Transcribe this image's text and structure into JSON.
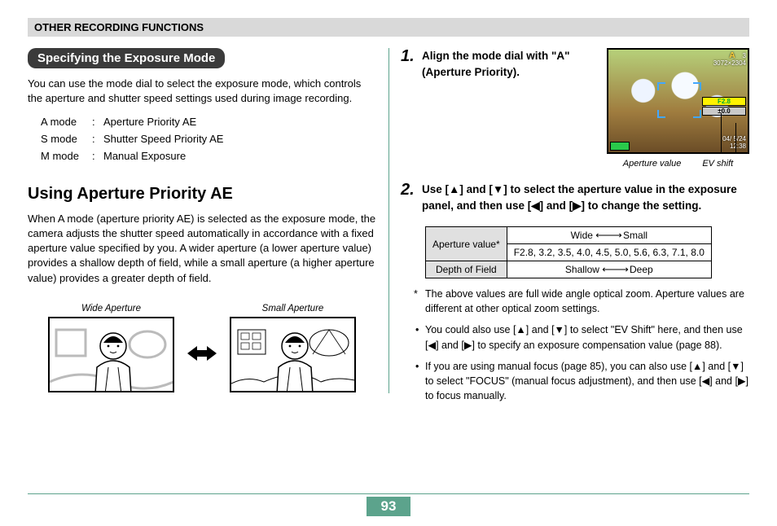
{
  "chapter": "OTHER RECORDING FUNCTIONS",
  "section_title": "Specifying the Exposure Mode",
  "intro": "You can use the mode dial to select the exposure mode, which controls the aperture and shutter speed settings used during image recording.",
  "modes": [
    {
      "k": "A mode",
      "v": "Aperture Priority AE"
    },
    {
      "k": "S mode",
      "v": "Shutter Speed Priority AE"
    },
    {
      "k": "M mode",
      "v": "Manual Exposure"
    }
  ],
  "sub_heading": "Using Aperture Priority AE",
  "sub_body": "When A mode (aperture priority AE) is selected as the exposure mode, the camera adjusts the shutter speed automatically in accordance with a fixed aperture value specified by you. A wider aperture (a lower aperture value) provides a shallow depth of field, while a small aperture (a higher aperture value) provides a greater depth of field.",
  "fig_wide_cap": "Wide Aperture",
  "fig_small_cap": "Small Aperture",
  "step1_num": "1.",
  "step1_text": "Align the mode dial with \"A\" (Aperture Priority).",
  "screen": {
    "a_label": "A",
    "count": "3",
    "res": "3072×2304",
    "f": "F2.8",
    "ev": "±0.0",
    "date": "04/ 5/24",
    "time": "12:38",
    "caption_l": "Aperture value",
    "caption_r": "EV shift"
  },
  "step2_num": "2.",
  "step2_text": "Use [▲] and [▼] to select the aperture value in the exposure panel, and then use [◀] and [▶] to change the setting.",
  "table": {
    "row1_label": "Aperture value*",
    "row1_scale_l": "Wide",
    "row1_scale_r": "Small",
    "row1_values": "F2.8, 3.2, 3.5, 4.0, 4.5, 5.0, 5.6, 6.3, 7.1, 8.0",
    "row2_label": "Depth of Field",
    "row2_scale_l": "Shallow",
    "row2_scale_r": "Deep"
  },
  "footnote": "The above values are full wide angle optical zoom. Aperture values are different at other optical zoom settings.",
  "bullets": [
    "You could also use [▲] and [▼] to select \"EV Shift\" here, and then use [◀] and [▶] to specify an exposure compensation value (page 88).",
    "If you are using manual focus (page 85), you can also use [▲] and [▼] to select \"FOCUS\" (manual focus adjustment), and then use [◀] and [▶] to focus manually."
  ],
  "page_number": "93"
}
